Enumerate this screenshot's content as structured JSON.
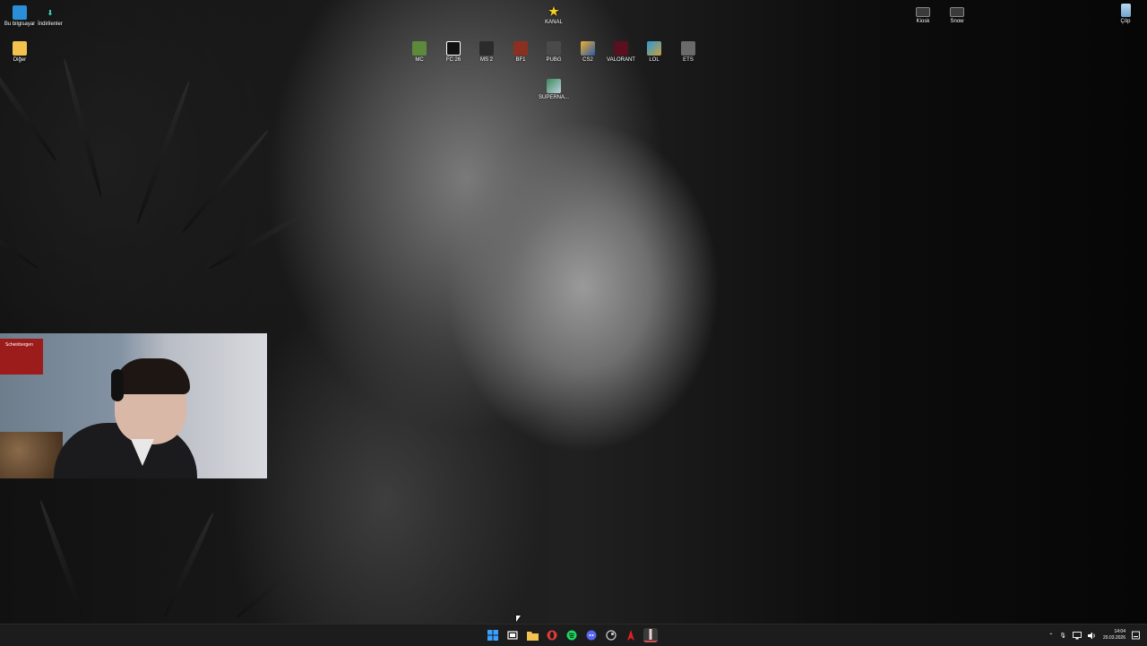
{
  "desktop": {
    "left_icons": [
      {
        "label": "Bu bilgisayar",
        "icon": "this-pc-icon"
      },
      {
        "label": "İndirilenler",
        "icon": "downloads-icon"
      },
      {
        "label": "Diğer",
        "icon": "folder-icon"
      }
    ],
    "top_icons": [
      {
        "label": "KANAL",
        "icon": "star-icon"
      },
      {
        "label": "MC",
        "icon": "minecraft-icon"
      },
      {
        "label": "FC 26",
        "icon": "fc26-icon"
      },
      {
        "label": "MS 2",
        "icon": "ms2-icon"
      },
      {
        "label": "BF1",
        "icon": "bf1-icon"
      },
      {
        "label": "PUBG",
        "icon": "pubg-icon"
      },
      {
        "label": "CS2",
        "icon": "cs2-icon"
      },
      {
        "label": "VALORANT",
        "icon": "valorant-icon"
      },
      {
        "label": "LOL",
        "icon": "lol-icon"
      },
      {
        "label": "ETS",
        "icon": "ets-icon"
      },
      {
        "label": "SUPERNA...",
        "icon": "superna-icon"
      }
    ],
    "right_icons": [
      {
        "label": "Kiosk",
        "icon": "kiosk-icon"
      },
      {
        "label": "Snow",
        "icon": "snow-icon"
      },
      {
        "label": "Çöp",
        "icon": "recycle-bin-icon"
      }
    ]
  },
  "webcam": {
    "flag_text": "Scheinbergen"
  },
  "taskbar": {
    "apps": [
      {
        "icon": "start-icon",
        "color": "#3aa0ff"
      },
      {
        "icon": "task-view-icon",
        "color": "#ffffff"
      },
      {
        "icon": "file-explorer-icon",
        "color": "#f2c14e"
      },
      {
        "icon": "opera-icon",
        "color": "#e03a3a"
      },
      {
        "icon": "spotify-icon",
        "color": "#1ed760"
      },
      {
        "icon": "discord-icon",
        "color": "#5865f2"
      },
      {
        "icon": "steam-icon",
        "color": "#c8c8c8"
      },
      {
        "icon": "red-app-icon",
        "color": "#e02020"
      },
      {
        "icon": "obs-icon",
        "color": "#d05050"
      }
    ],
    "clock_time": "14:04",
    "clock_date": "20.03.2026"
  }
}
